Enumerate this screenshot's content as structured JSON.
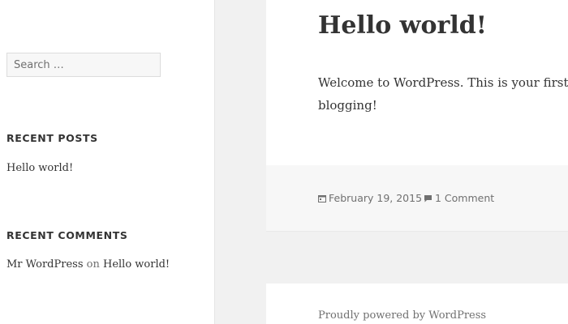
{
  "sidebar": {
    "search": {
      "placeholder": "Search …"
    },
    "recent_posts": {
      "title": "RECENT POSTS",
      "items": [
        "Hello world!"
      ]
    },
    "recent_comments": {
      "title": "RECENT COMMENTS",
      "author": "Mr WordPress",
      "connector": "on",
      "post": "Hello world!"
    }
  },
  "post": {
    "title": "Hello world!",
    "body_line1": "Welcome to WordPress. This is your first p",
    "body_line2": "blogging!",
    "date": "February 19, 2015",
    "comments": "1 Comment"
  },
  "footer": {
    "credit": "Proudly powered by WordPress"
  },
  "colors": {
    "text": "#333333",
    "muted": "#707070",
    "background": "#f1f1f1"
  }
}
